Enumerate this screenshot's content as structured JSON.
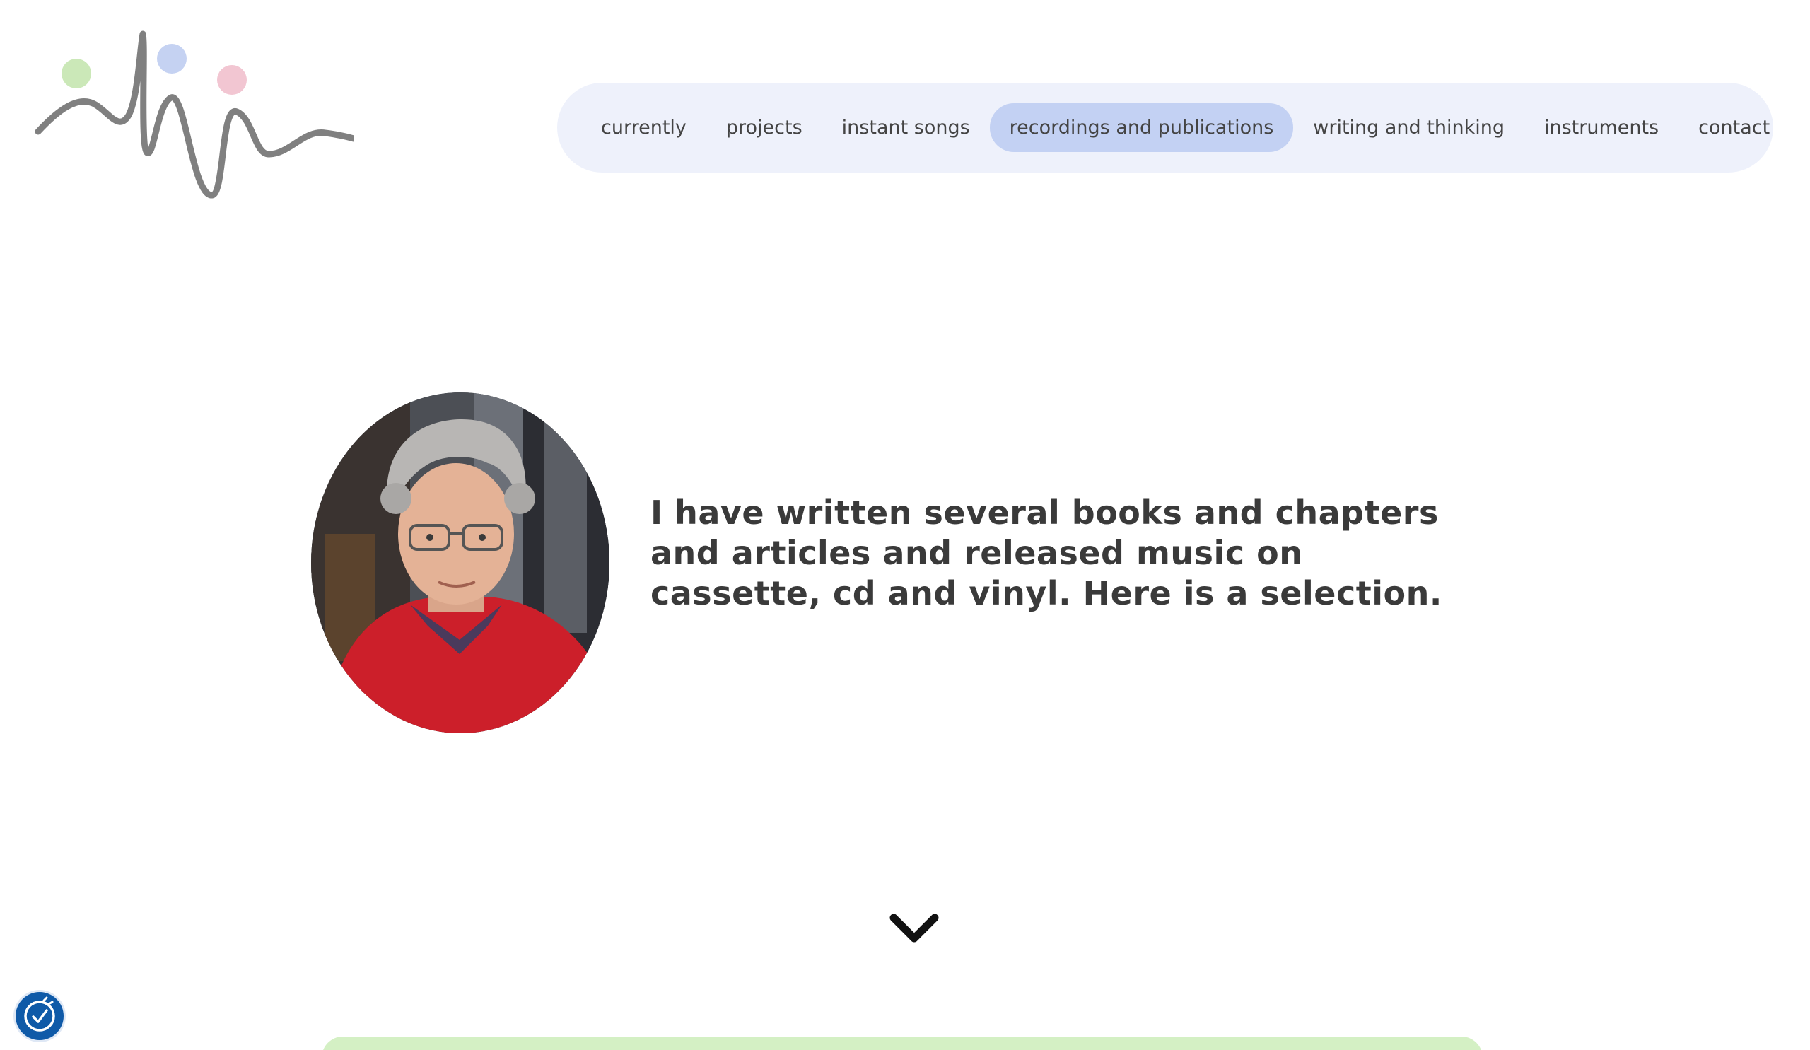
{
  "nav": {
    "items": [
      {
        "label": "currently",
        "active": false
      },
      {
        "label": "projects",
        "active": false
      },
      {
        "label": "instant songs",
        "active": false
      },
      {
        "label": "recordings and publications",
        "active": true
      },
      {
        "label": "writing and thinking",
        "active": false
      },
      {
        "label": "instruments",
        "active": false
      },
      {
        "label": "contact",
        "active": false
      }
    ]
  },
  "hero": {
    "intro_text": "I have written several books and chapters and articles and released music on cassette, cd and vinyl. Here is a selection."
  },
  "icons": {
    "logo": "waveform-with-dots-logo",
    "scroll_down": "chevron-down-icon",
    "accessibility": "accessibility-icon"
  },
  "colors": {
    "nav_background": "#eef1fb",
    "nav_active": "#c3d1f3",
    "logo_line": "#808080",
    "logo_dot_green": "#cbe8b8",
    "logo_dot_blue": "#c5d2f2",
    "logo_dot_pink": "#f2c6d2",
    "text": "#3a3a3a",
    "accessibility_button": "#0f5aa8",
    "card_green": "#d4f0c4"
  }
}
